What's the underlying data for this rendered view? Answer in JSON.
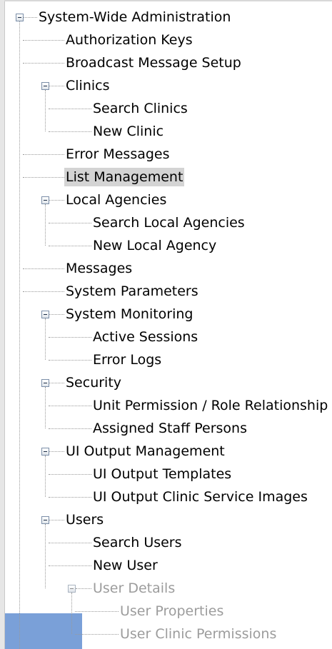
{
  "tree": {
    "root": {
      "label": "System-Wide Administration",
      "expanded": true
    },
    "items": [
      {
        "label": "Authorization Keys"
      },
      {
        "label": "Broadcast Message Setup"
      },
      {
        "label": "Clinics",
        "expanded": true,
        "children": [
          "Search Clinics",
          "New Clinic"
        ]
      },
      {
        "label": "Error Messages"
      },
      {
        "label": "List Management",
        "highlighted": true
      },
      {
        "label": "Local Agencies",
        "expanded": true,
        "children": [
          "Search Local Agencies",
          "New Local Agency"
        ]
      },
      {
        "label": "Messages"
      },
      {
        "label": "System Parameters"
      },
      {
        "label": "System Monitoring",
        "expanded": true,
        "children": [
          "Active Sessions",
          "Error Logs"
        ]
      },
      {
        "label": "Security",
        "expanded": true,
        "children": [
          "Unit Permission / Role Relationship",
          "Assigned Staff Persons"
        ]
      },
      {
        "label": "UI Output Management",
        "expanded": true,
        "children": [
          "UI Output Templates",
          "UI Output Clinic Service Images"
        ]
      },
      {
        "label": "Users",
        "expanded": true,
        "children": [
          "Search Users",
          "New User"
        ],
        "subgroup": {
          "label": "User Details",
          "expanded": true,
          "disabled": true,
          "children": [
            "User Properties",
            "User Clinic Permissions"
          ]
        }
      }
    ]
  },
  "colors": {
    "text": "#000000",
    "disabled_text": "#9c9c9c",
    "highlight": "#d4d4d4",
    "selection_block": "#7aa0d8",
    "connector": "#9a9a9a"
  }
}
